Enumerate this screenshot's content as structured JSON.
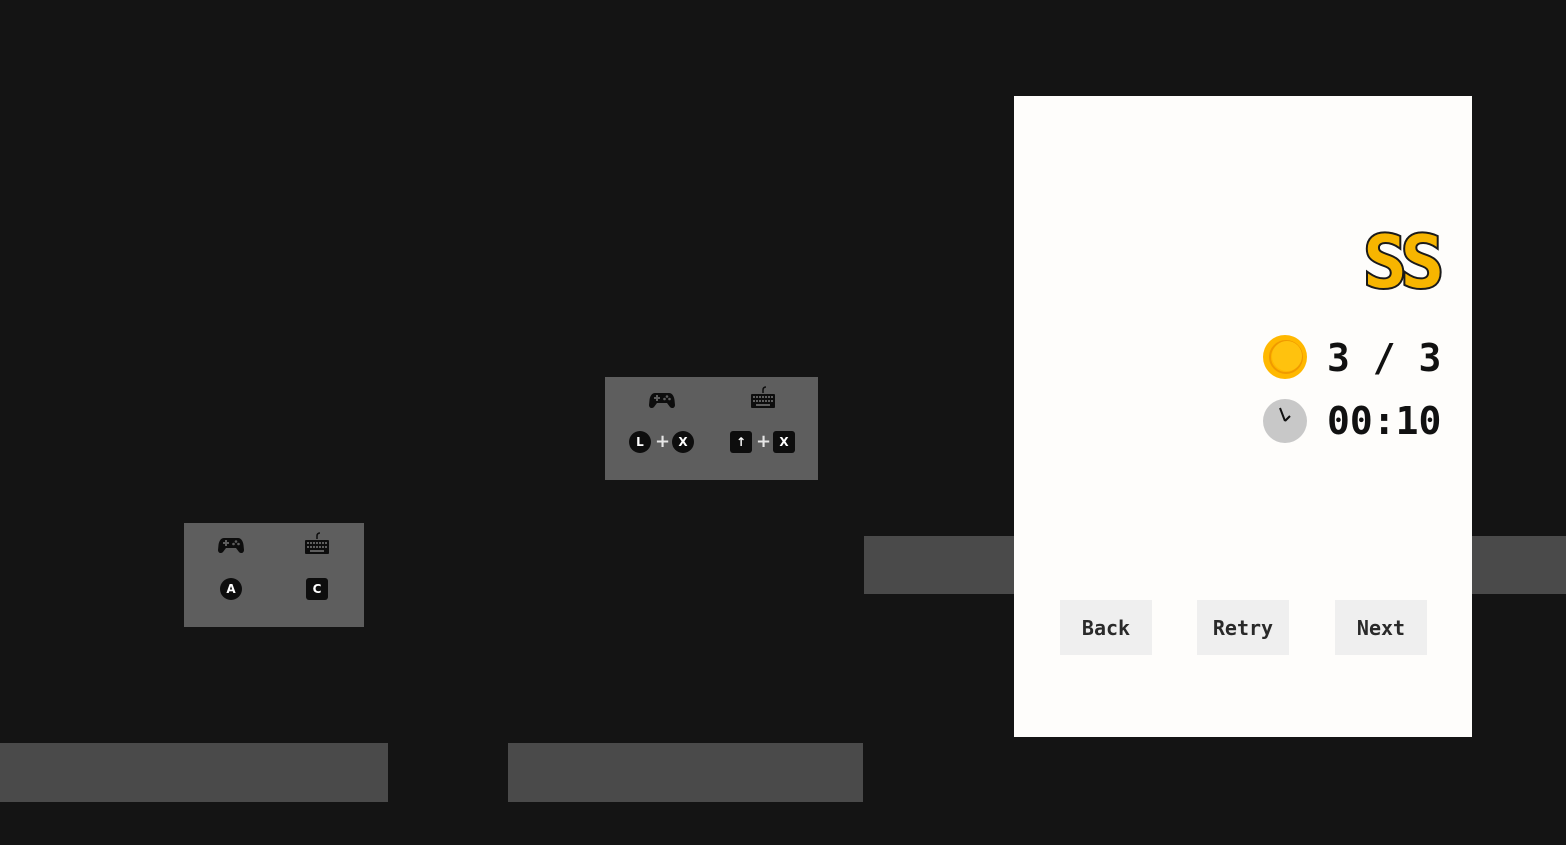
{
  "colors": {
    "background": "#141414",
    "platform": "#4a4a4a",
    "hint_box": "#5e5e5e",
    "panel": "#fefdfb",
    "rank_gold": "#f7b500",
    "coin": "#ffb800",
    "clock": "#c8c8c8",
    "button": "#efefef"
  },
  "hints": [
    {
      "gamepad_icon": "gamepad-icon",
      "keyboard_icon": "keyboard-icon",
      "gamepad_keys": [
        "A"
      ],
      "keyboard_keys": [
        "C"
      ]
    },
    {
      "gamepad_icon": "gamepad-icon",
      "keyboard_icon": "keyboard-icon",
      "gamepad_keys": [
        "L",
        "+",
        "X"
      ],
      "keyboard_keys": [
        "↑",
        "+",
        "X"
      ]
    }
  ],
  "results": {
    "rank": "SS",
    "coins": "3 / 3",
    "coin_icon": "coin-icon",
    "time": "00:10",
    "clock_icon": "clock-icon"
  },
  "buttons": {
    "back": "Back",
    "retry": "Retry",
    "next": "Next"
  }
}
